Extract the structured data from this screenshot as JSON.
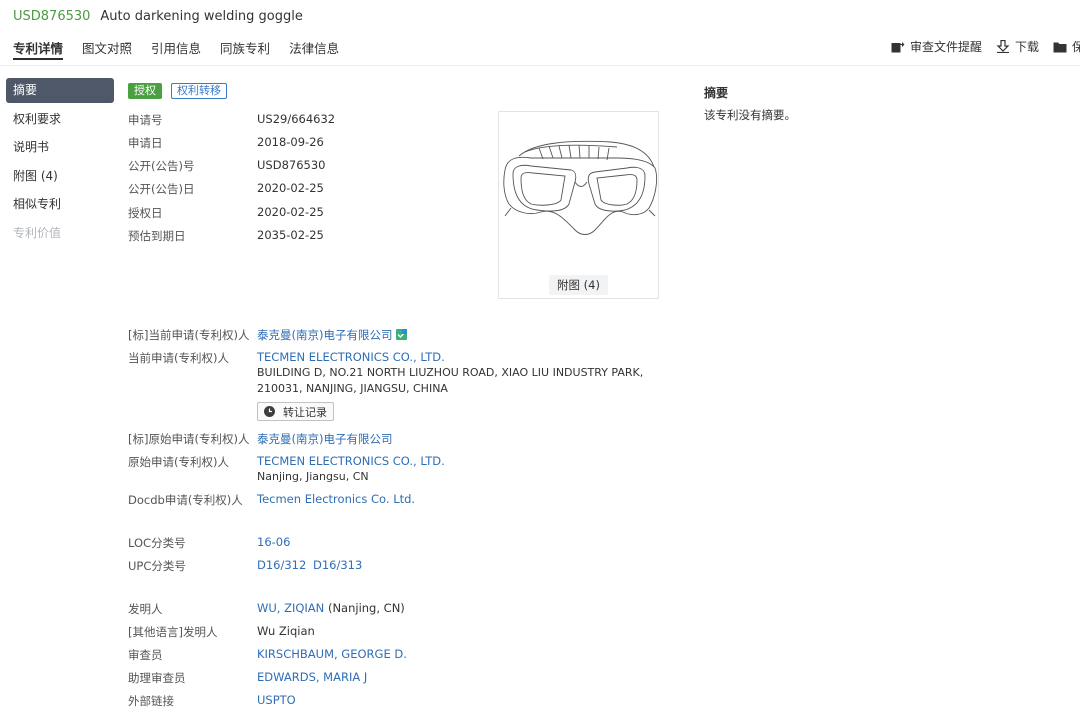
{
  "header": {
    "patent_number": "USD876530",
    "title": "Auto darkening welding goggle",
    "tabs": [
      "专利详情",
      "图文对照",
      "引用信息",
      "同族专利",
      "法律信息"
    ],
    "tools": {
      "review": "审查文件提醒",
      "download": "下载",
      "save": "保"
    }
  },
  "sidebar": {
    "items": [
      {
        "label": "摘要",
        "state": "active"
      },
      {
        "label": "权利要求",
        "state": "normal"
      },
      {
        "label": "说明书",
        "state": "normal"
      },
      {
        "label": "附图 (4)",
        "state": "normal"
      },
      {
        "label": "相似专利",
        "state": "normal"
      },
      {
        "label": "专利价值",
        "state": "disabled"
      }
    ]
  },
  "status": {
    "granted": "授权",
    "transfer": "权利转移"
  },
  "bib": {
    "app_no_label": "申请号",
    "app_no": "US29/664632",
    "app_date_label": "申请日",
    "app_date": "2018-09-26",
    "pub_no_label": "公开(公告)号",
    "pub_no": "USD876530",
    "pub_date_label": "公开(公告)日",
    "pub_date": "2020-02-25",
    "grant_date_label": "授权日",
    "grant_date": "2020-02-25",
    "expiry_label": "预估到期日",
    "expiry": "2035-02-25"
  },
  "figure": {
    "caption": "附图 (4)"
  },
  "abstract": {
    "title": "摘要",
    "text": "该专利没有摘要。"
  },
  "parties": {
    "std_current_label": "[标]当前申请(专利权)人",
    "std_current": "泰克曼(南京)电子有限公司",
    "current_label": "当前申请(专利权)人",
    "current_name": "TECMEN ELECTRONICS CO., LTD.",
    "current_addr1": "BUILDING D, NO.21 NORTH LIUZHOU ROAD, XIAO LIU INDUSTRY PARK,",
    "current_addr2": "210031, NANJING, JIANGSU, CHINA",
    "transfer_record": "转让记录",
    "std_original_label": "[标]原始申请(专利权)人",
    "std_original": "泰克曼(南京)电子有限公司",
    "original_label": "原始申请(专利权)人",
    "original_name": "TECMEN ELECTRONICS CO., LTD.",
    "original_loc": "Nanjing, Jiangsu, CN",
    "docdb_label": "Docdb申请(专利权)人",
    "docdb": "Tecmen Electronics Co. Ltd."
  },
  "classification": {
    "loc_label": "LOC分类号",
    "loc": "16-06",
    "upc_label": "UPC分类号",
    "upc1": "D16/312",
    "upc2": "D16/313"
  },
  "people": {
    "inventor_label": "发明人",
    "inventor": "WU, ZIQIAN",
    "inventor_loc": "(Nanjing, CN)",
    "other_inventor_label": "[其他语言]发明人",
    "other_inventor": "Wu Ziqian",
    "examiner_label": "审查员",
    "examiner": "KIRSCHBAUM, GEORGE D.",
    "asst_examiner_label": "助理审查员",
    "asst_examiner": "EDWARDS, MARIA J",
    "ext_link_label": "外部链接",
    "ext_link": "USPTO"
  },
  "colors": {
    "patent_number": "#4b9a44",
    "link": "#2f6db5",
    "granted_badge": "#4aa040",
    "sidebar_active": "#4f5868"
  }
}
